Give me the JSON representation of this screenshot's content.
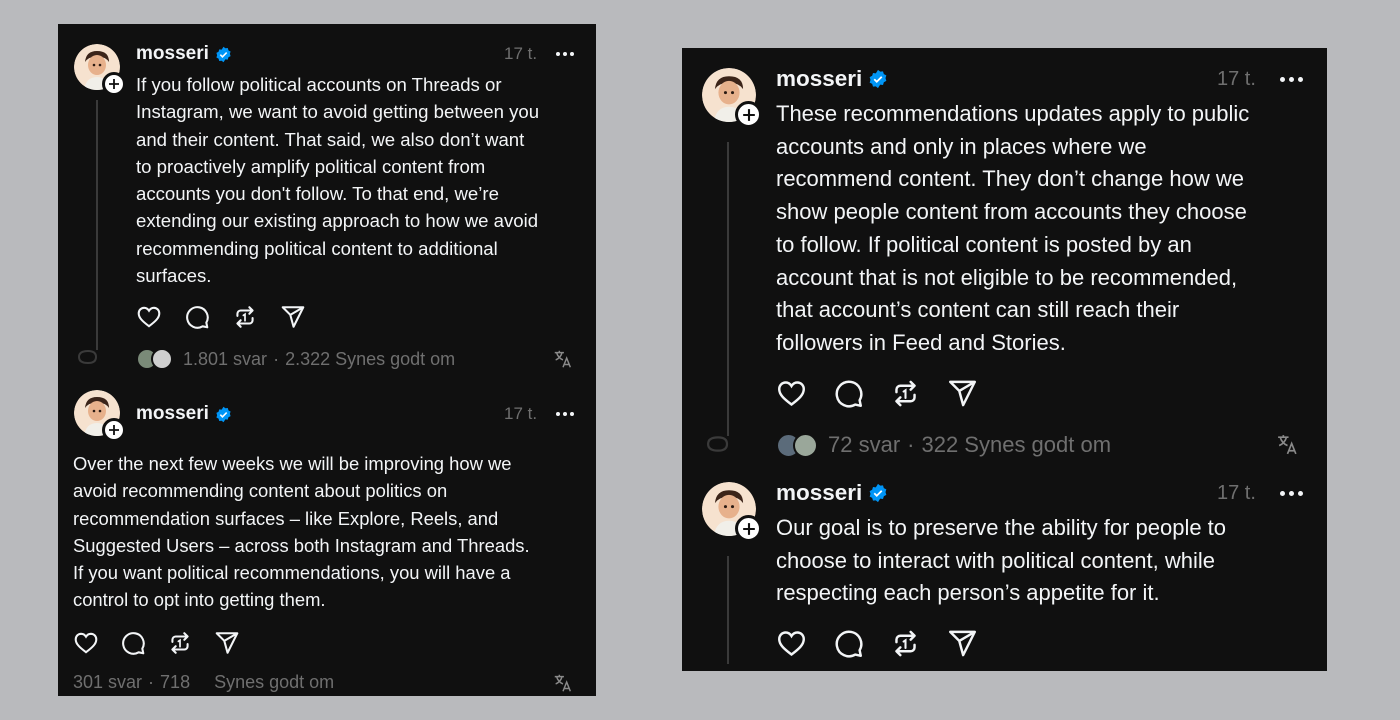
{
  "left": {
    "post1": {
      "username": "mosseri",
      "time": "17 t.",
      "text": "If you follow political accounts on Threads or\nInstagram, we want to avoid getting between you\nand their content. That said, we also don’t want\nto proactively amplify political content from\naccounts you don't follow. To that end, we’re\nextending our existing approach to how we avoid\nrecommending political content to additional\nsurfaces.",
      "replies": "1.801 svar",
      "separator": "·",
      "likes": "2.322 Synes godt om"
    },
    "post2": {
      "username": "mosseri",
      "time": "17 t.",
      "text": "Over the next few weeks we will be improving how we\navoid recommending content about politics on\nrecommendation surfaces –  like Explore, Reels, and\nSuggested Users – across both Instagram and Threads.\nIf you want political recommendations, you will have a\ncontrol to opt into getting them.",
      "replies": "301 svar",
      "separator": "·",
      "likes_count": "718",
      "likes_label": "Synes godt om"
    }
  },
  "right": {
    "post1": {
      "username": "mosseri",
      "time": "17 t.",
      "text": "These recommendations updates apply to public\naccounts and only in places where we\nrecommend content. They don’t change how we\nshow people content from accounts they choose\nto follow. If political content is posted by an\naccount that is not eligible to be recommended,\nthat account’s content can still reach their\nfollowers in Feed and Stories.",
      "replies": "72 svar",
      "separator": "·",
      "likes": "322 Synes godt om"
    },
    "post2": {
      "username": "mosseri",
      "time": "17 t.",
      "text": "Our goal is to preserve the ability for people to\nchoose to interact with political content, while\nrespecting each person’s appetite for it."
    }
  },
  "colors": {
    "background": "#b9babd",
    "panel": "#101010",
    "text": "#f3f5f7",
    "muted": "#6f6f6f",
    "verified": "#0095f6"
  },
  "icons": [
    "heart-icon",
    "comment-icon",
    "repost-icon",
    "share-icon",
    "more-icon",
    "translate-icon",
    "verified-icon",
    "follow-plus-icon"
  ]
}
